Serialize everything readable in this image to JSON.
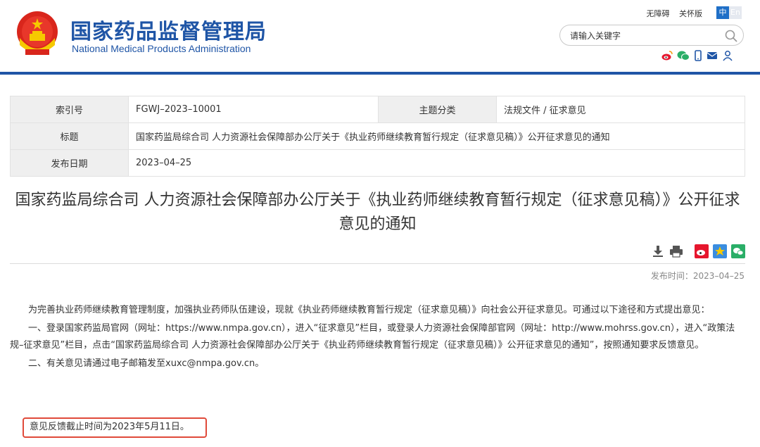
{
  "header": {
    "title_cn": "国家药品监督管理局",
    "title_en": "National Medical Products Administration",
    "links": [
      "无障碍",
      "关怀版"
    ],
    "lang": [
      "中",
      "En"
    ],
    "search_placeholder": "请输入关键字",
    "social_icons": [
      "weibo-icon",
      "wechat-icon",
      "mobile-icon",
      "mail-icon",
      "user-icon"
    ]
  },
  "info": {
    "index_label": "索引号",
    "index_value": "FGWJ–2023–10001",
    "category_label": "主题分类",
    "category_value": "法规文件 / 征求意见",
    "title_label": "标题",
    "title_value": "国家药监局综合司 人力资源社会保障部办公厅关于《执业药师继续教育暂行规定（征求意见稿）》公开征求意见的通知",
    "date_label": "发布日期",
    "date_value": "2023–04–25"
  },
  "article": {
    "title": "国家药监局综合司 人力资源社会保障部办公厅关于《执业药师继续教育暂行规定（征求意见稿）》公开征求意见的通知",
    "pubtime": "发布时间：2023–04–25",
    "p1": "为完善执业药师继续教育管理制度，加强执业药师队伍建设，现就《执业药师继续教育暂行规定（征求意见稿）》向社会公开征求意见。可通过以下途径和方式提出意见：",
    "p2": "一、登录国家药监局官网（网址：https://www.nmpa.gov.cn），进入“征求意见”栏目，或登录人力资源社会保障部官网（网址：http://www.mohrss.gov.cn），进入“政策法规–征求意见”栏目，点击“国家药监局综合司 人力资源社会保障部办公厅关于《执业药师继续教育暂行规定（征求意见稿）》公开征求意见的通知”，按照通知要求反馈意见。",
    "p3": "二、有关意见请通过电子邮箱发至xuxc@nmpa.gov.cn。",
    "p4": "意见反馈截止时间为2023年5月11日。"
  },
  "colors": {
    "brand_blue": "#1f55a6",
    "highlight_red": "#e04a3a"
  }
}
